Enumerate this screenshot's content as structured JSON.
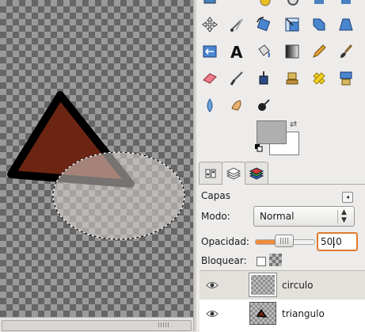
{
  "toolbox": {
    "tools": [
      {
        "name": "move-icon"
      },
      {
        "name": "crop-icon"
      },
      {
        "name": "rotate-icon"
      },
      {
        "name": "scale-icon"
      },
      {
        "name": "shear-icon"
      },
      {
        "name": "perspective-icon"
      },
      {
        "name": "flip-icon"
      },
      {
        "name": "text-icon"
      },
      {
        "name": "bucket-fill-icon"
      },
      {
        "name": "blend-gradient-icon"
      },
      {
        "name": "pencil-icon"
      },
      {
        "name": "paintbrush-icon"
      },
      {
        "name": "eraser-icon"
      },
      {
        "name": "airbrush-icon"
      },
      {
        "name": "ink-icon"
      },
      {
        "name": "clone-icon"
      },
      {
        "name": "heal-icon"
      },
      {
        "name": "perspective-clone-icon"
      },
      {
        "name": "blur-icon"
      },
      {
        "name": "smudge-icon"
      },
      {
        "name": "dodge-burn-icon"
      }
    ],
    "fg_color": "#b0afaf",
    "bg_color": "#ffffff"
  },
  "dock": {
    "tabs": [
      "tool-options-tab",
      "layers-tab",
      "colormap-tab"
    ],
    "panel_title": "Capas",
    "mode_label": "Modo:",
    "mode_value": "Normal",
    "opacity_label": "Opacidad:",
    "opacity_value": "50,0",
    "opacity_fraction": 0.5,
    "lock_label": "Bloquear:"
  },
  "layers": [
    {
      "name": "circulo",
      "selected": true,
      "visible": true
    },
    {
      "name": "triangulo",
      "selected": false,
      "visible": true
    }
  ],
  "colors": {
    "triangle_fill": "#6b2512",
    "accent": "#f08a3c"
  }
}
